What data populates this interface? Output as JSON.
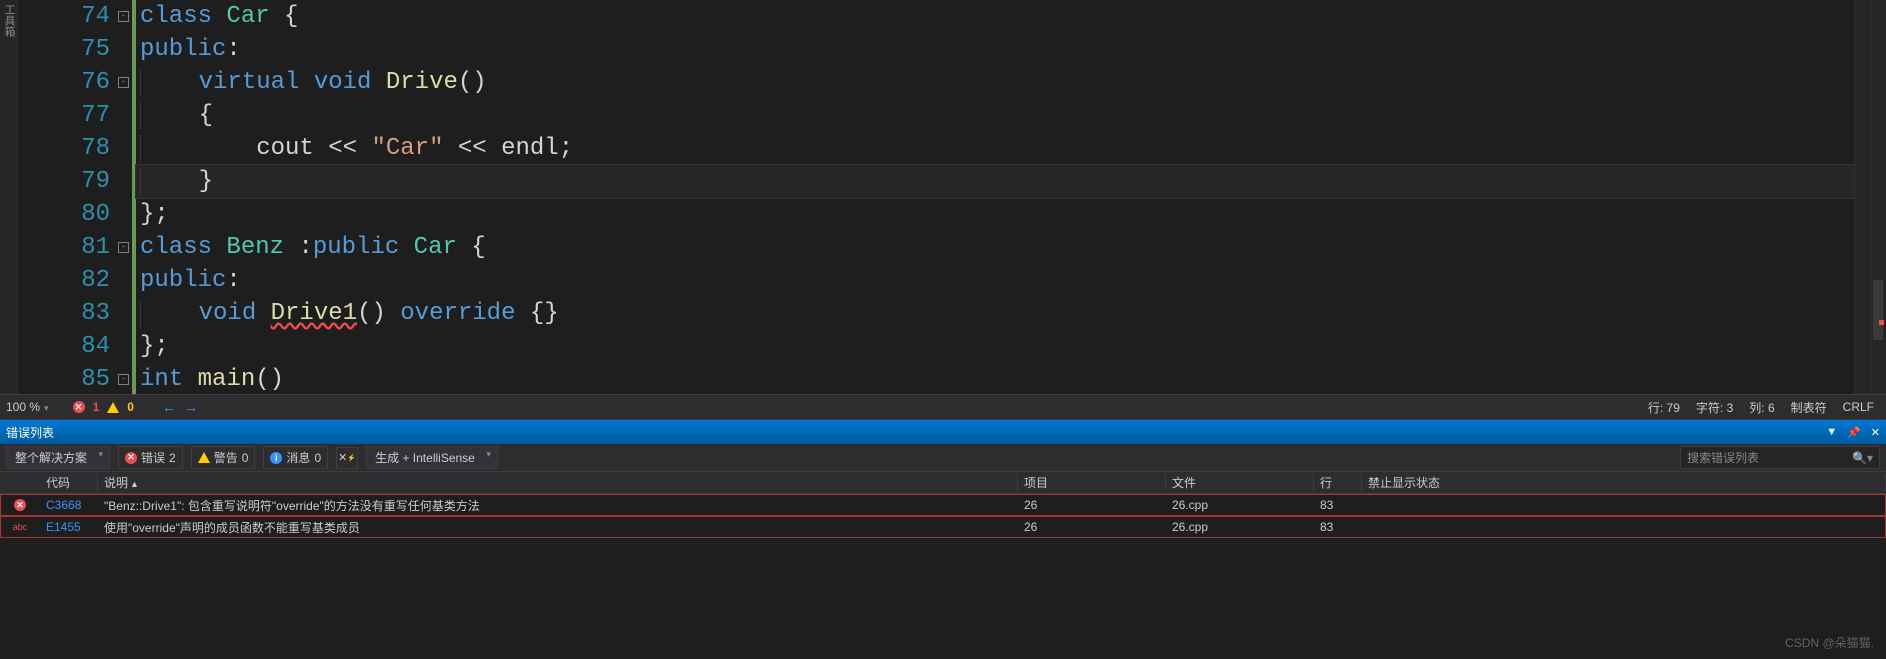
{
  "left_label": "工具箱",
  "code": {
    "lines": [
      {
        "n": 74
      },
      {
        "n": 75
      },
      {
        "n": 76
      },
      {
        "n": 77
      },
      {
        "n": 78
      },
      {
        "n": 79
      },
      {
        "n": 80
      },
      {
        "n": 81
      },
      {
        "n": 82
      },
      {
        "n": 83
      },
      {
        "n": 84
      },
      {
        "n": 85
      }
    ],
    "t74": {
      "kw1": "class",
      "cls": "Car",
      "br": "{"
    },
    "t75": {
      "kw": "public",
      "col": ":"
    },
    "t76": {
      "kw1": "virtual",
      "kw2": "void",
      "fn": "Drive",
      "par": "()"
    },
    "t77": {
      "br": "{"
    },
    "t78": {
      "id": "cout",
      "op1": "<<",
      "str": "\"Car\"",
      "op2": "<<",
      "endl": "endl",
      "semi": ";"
    },
    "t79": {
      "br": "}"
    },
    "t80": {
      "br": "};"
    },
    "t81": {
      "kw1": "class",
      "cls1": "Benz",
      "col": ":",
      "kw2": "public",
      "cls2": "Car",
      "br": "{"
    },
    "t82": {
      "kw": "public",
      "col": ":"
    },
    "t83": {
      "kw1": "void",
      "fn": "Drive1",
      "par": "()",
      "kw2": "override",
      "br": "{}"
    },
    "t84": {
      "br": "};"
    },
    "t85": {
      "kw1": "int",
      "fn": "main",
      "par": "()"
    }
  },
  "status": {
    "zoom": "100 %",
    "errors": "1",
    "warnings": "0",
    "line_lbl": "行:",
    "line": "79",
    "char_lbl": "字符:",
    "char": "3",
    "col_lbl": "列:",
    "col": "6",
    "tabs": "制表符",
    "crlf": "CRLF"
  },
  "panel": {
    "title": "错误列表"
  },
  "filters": {
    "scope": "整个解决方案",
    "errors_lbl": "错误",
    "errors_n": "2",
    "warnings_lbl": "警告",
    "warnings_n": "0",
    "messages_lbl": "消息",
    "messages_n": "0",
    "build": "生成 + IntelliSense",
    "search_ph": "搜索错误列表"
  },
  "table": {
    "headers": {
      "code": "代码",
      "desc": "说明",
      "proj": "项目",
      "file": "文件",
      "line": "行",
      "supp": "禁止显示状态"
    },
    "rows": [
      {
        "icon": "err",
        "code": "C3668",
        "desc": "\"Benz::Drive1\": 包含重写说明符\"override\"的方法没有重写任何基类方法",
        "proj": "26",
        "file": "26.cpp",
        "line": "83"
      },
      {
        "icon": "abc",
        "code": "E1455",
        "desc": "使用\"override\"声明的成员函数不能重写基类成员",
        "proj": "26",
        "file": "26.cpp",
        "line": "83"
      }
    ]
  },
  "watermark": "CSDN @朵猫猫."
}
